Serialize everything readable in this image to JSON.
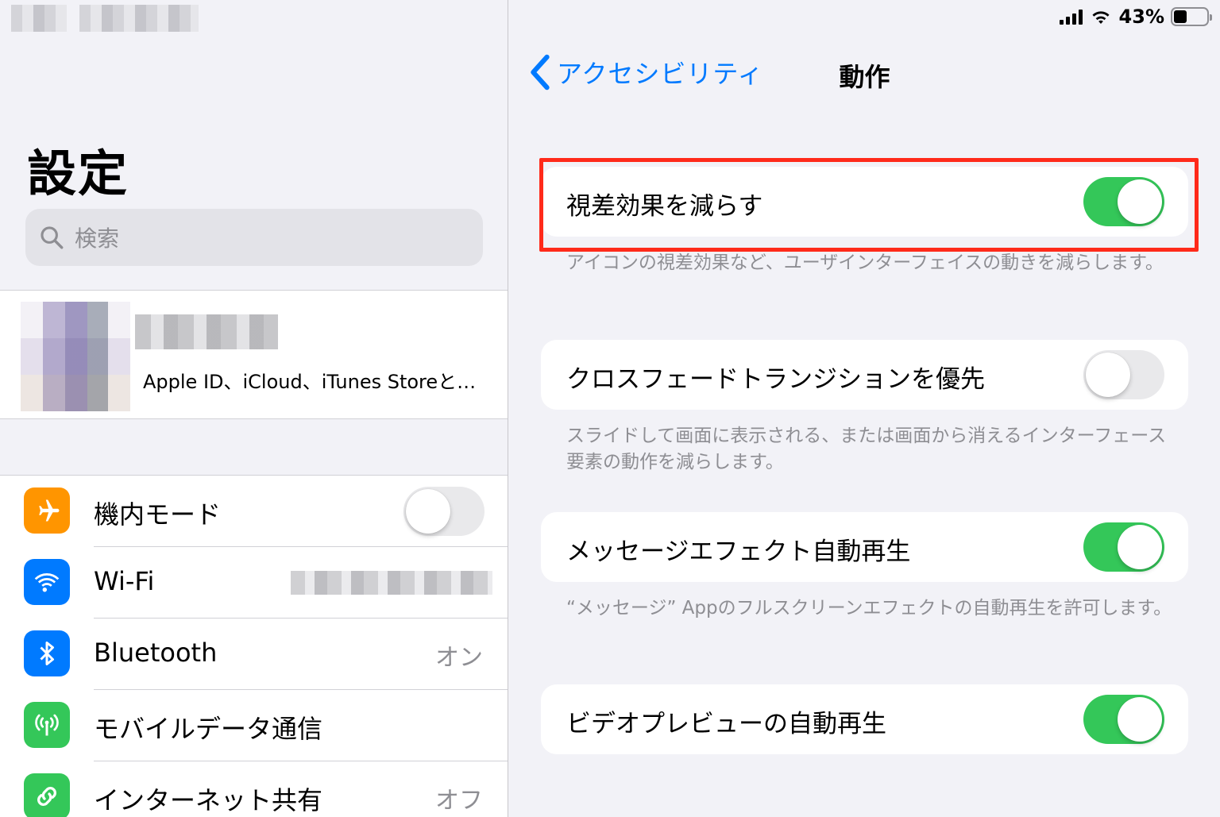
{
  "left": {
    "title": "設定",
    "search_placeholder": "検索",
    "account_subtitle": "Apple ID、iCloud、iTunes Storeと…",
    "rows": [
      {
        "label": "機内モード",
        "icon": "airplane-icon",
        "color": "#ff9500",
        "toggle": false
      },
      {
        "label": "Wi-Fi",
        "icon": "wifi-icon",
        "color": "#007aff"
      },
      {
        "label": "Bluetooth",
        "icon": "bluetooth-icon",
        "color": "#007aff",
        "value": "オン"
      },
      {
        "label": "モバイルデータ通信",
        "icon": "antenna-icon",
        "color": "#34c759"
      },
      {
        "label": "インターネット共有",
        "icon": "link-icon",
        "color": "#34c759",
        "value": "オフ"
      }
    ]
  },
  "status": {
    "battery": "43%"
  },
  "nav": {
    "back": "アクセシビリティ",
    "title": "動作"
  },
  "settings": [
    {
      "label": "視差効果を減らす",
      "toggle": true,
      "note": "アイコンの視差効果など、ユーザインターフェイスの動きを減らします。"
    },
    {
      "label": "クロスフェードトランジションを優先",
      "toggle": false,
      "note": "スライドして画面に表示される、または画面から消えるインターフェース要素の動作を減らします。"
    },
    {
      "label": "メッセージエフェクト自動再生",
      "toggle": true,
      "note": "“メッセージ” Appのフルスクリーンエフェクトの自動再生を許可します。"
    },
    {
      "label": "ビデオプレビューの自動再生",
      "toggle": true
    }
  ],
  "colors": {
    "accent": "#007aff",
    "toggle_on": "#34c759",
    "highlight": "#ff2a1a"
  }
}
